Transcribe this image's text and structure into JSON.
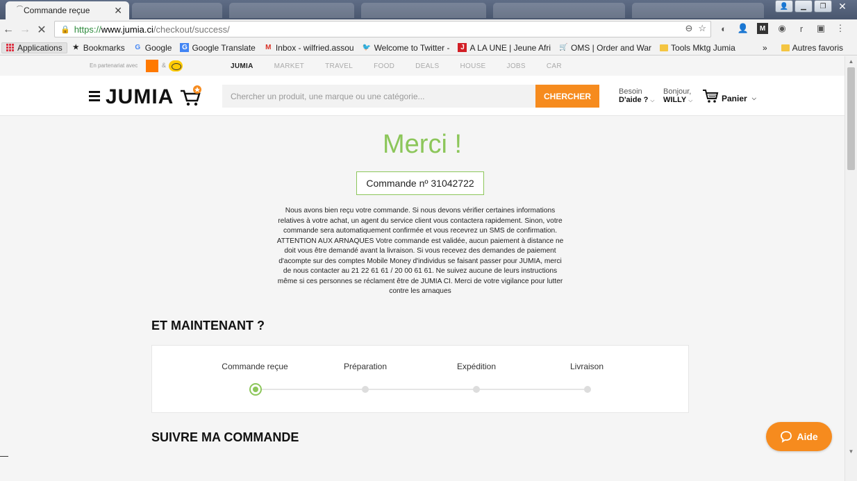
{
  "browser": {
    "tab_title": "Commande reçue",
    "tab_close": "✕",
    "url_scheme": "https://",
    "url_host": "www.jumia.ci",
    "url_path": "/checkout/success/",
    "bookmarks": [
      {
        "label": "Applications",
        "icon": "apps-grid-icon"
      },
      {
        "label": "Bookmarks",
        "icon": "star-icon"
      },
      {
        "label": "Google",
        "icon": "google-icon"
      },
      {
        "label": "Google Translate",
        "icon": "translate-icon"
      },
      {
        "label": "Inbox - wilfried.assou",
        "icon": "gmail-icon"
      },
      {
        "label": "Welcome to Twitter -",
        "icon": "twitter-icon"
      },
      {
        "label": "A LA UNE | Jeune Afri",
        "icon": "news-icon"
      },
      {
        "label": "OMS | Order and War",
        "icon": "cart-icon"
      },
      {
        "label": "Tools Mktg Jumia",
        "icon": "folder-icon"
      }
    ],
    "bookmarks_overflow": "»",
    "other_bookmarks": "Autres favoris"
  },
  "partner": {
    "text": "En partenariat avec",
    "amp": "&"
  },
  "verticals": [
    "JUMIA",
    "MARKET",
    "TRAVEL",
    "FOOD",
    "DEALS",
    "HOUSE",
    "JOBS",
    "CAR"
  ],
  "header": {
    "logo": "JUMIA",
    "search_placeholder": "Chercher un produit, une marque ou une catégorie...",
    "search_button": "CHERCHER",
    "help_line1": "Besoin",
    "help_line2": "D'aide ?",
    "hello_line1": "Bonjour,",
    "hello_line2": "WILLY",
    "cart_label": "Panier"
  },
  "confirmation": {
    "title": "Merci !",
    "order_number": "Commande nº 31042722",
    "message": "Nous avons bien reçu votre commande. Si nous devons vérifier certaines informations relatives à votre achat, un agent du service client vous contactera rapidement. Sinon, votre commande sera automatiquement confirmée et vous recevrez un SMS de confirmation. ATTENTION AUX ARNAQUES Votre commande est validée, aucun paiement à distance ne doit vous être demandé avant la livraison. Si vous recevez des demandes de paiement d'acompte sur des comptes Mobile Money d'individus se faisant passer pour JUMIA, merci de nous contacter au 21 22 61 61 / 20 00 61 61. Ne suivez aucune de leurs instructions même si ces personnes se réclament être de JUMIA CI. Merci de votre vigilance pour lutter contre les arnaques"
  },
  "next_steps": {
    "heading": "ET MAINTENANT ?",
    "steps": [
      {
        "label": "Commande reçue",
        "done": true
      },
      {
        "label": "Préparation",
        "done": false
      },
      {
        "label": "Expédition",
        "done": false
      },
      {
        "label": "Livraison",
        "done": false
      }
    ]
  },
  "follow": {
    "heading": "SUIVRE MA COMMANDE"
  },
  "help_widget": {
    "label": "Aide"
  },
  "colors": {
    "accent_orange": "#f68b1e",
    "success_green": "#8cc65a"
  }
}
